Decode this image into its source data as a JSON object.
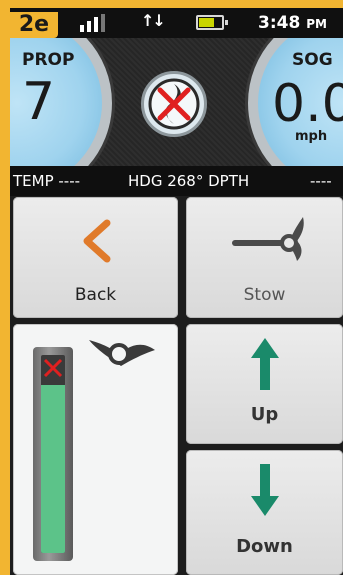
{
  "status": {
    "badge": "2e",
    "time": "3:48",
    "ampm": "PM",
    "signal_icon": "signal-bars-icon",
    "data_icon": "up-down-arrows-icon",
    "battery_icon": "battery-icon"
  },
  "gauges": {
    "left_label": "PROP",
    "left_value": "7",
    "right_label": "SOG",
    "right_value": "0.0",
    "right_unit": "mph",
    "center_icon": "prop-disabled-icon"
  },
  "info_bar": {
    "temp": "TEMP ----",
    "heading": "HDG 268° DPTH",
    "depth": "----"
  },
  "buttons": {
    "back": "Back",
    "stow": "Stow",
    "up": "Up",
    "down": "Down"
  },
  "trim": {
    "level_percent": 85,
    "state_icon": "x-mark-icon"
  },
  "colors": {
    "accent": "#f2b531",
    "up_down_arrow": "#1a8a6a",
    "back_chevron": "#e07a2a",
    "gauge": "#9fd3ee",
    "trim_fill": "#5cc389"
  }
}
